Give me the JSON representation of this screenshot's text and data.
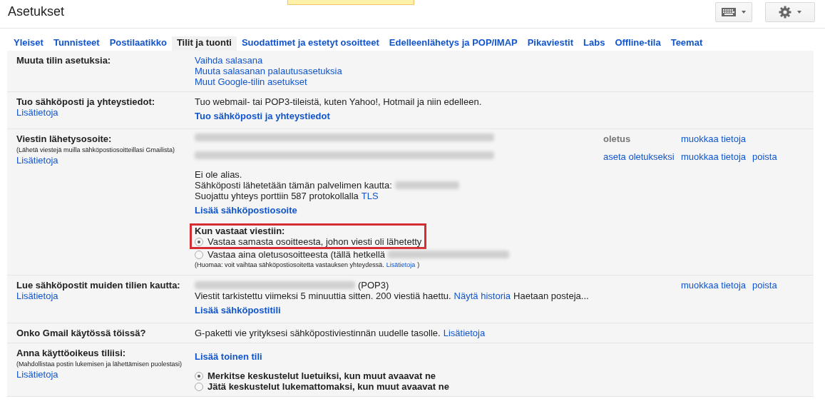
{
  "header": {
    "title": "Asetukset"
  },
  "tabs": [
    {
      "label": "Yleiset",
      "selected": false
    },
    {
      "label": "Tunnisteet",
      "selected": false
    },
    {
      "label": "Postilaatikko",
      "selected": false
    },
    {
      "label": "Tilit ja tuonti",
      "selected": true
    },
    {
      "label": "Suodattimet ja estetyt osoitteet",
      "selected": false
    },
    {
      "label": "Edelleenlähetys ja POP/IMAP",
      "selected": false
    },
    {
      "label": "Pikaviestit",
      "selected": false
    },
    {
      "label": "Labs",
      "selected": false
    },
    {
      "label": "Offline-tila",
      "selected": false
    },
    {
      "label": "Teemat",
      "selected": false
    }
  ],
  "sections": [
    {
      "title": "Muuta tilin asetuksia:",
      "lines": [
        {
          "kind": "plain",
          "parts": [
            {
              "kind": "link",
              "text": "Vaihda salasana"
            }
          ]
        },
        {
          "kind": "plain",
          "parts": [
            {
              "kind": "link",
              "text": "Muuta salasanan palautusasetuksia"
            }
          ]
        },
        {
          "kind": "plain",
          "parts": [
            {
              "kind": "link",
              "text": "Muut Google-tilin asetukset"
            }
          ]
        }
      ]
    },
    {
      "title": "Tuo sähköposti ja yhteystiedot:",
      "info_link": "Lisätietoja",
      "lines": [
        {
          "kind": "plain",
          "parts": [
            {
              "kind": "text",
              "text": "Tuo webmail- tai POP3-tileistä, kuten Yahoo!, Hotmail ja niin edelleen."
            }
          ]
        },
        {
          "kind": "action",
          "parts": [
            {
              "kind": "link",
              "text": "Tuo sähköposti ja yhteystiedot"
            }
          ]
        }
      ]
    },
    {
      "title": "Viestin lähetysosoite:",
      "note": "(Lähetä viestejä muilla sähköpostiosoitteillasi Gmailista)",
      "info_link": "Lisätietoja",
      "lines": [
        {
          "kind": "address",
          "parts": [
            {
              "kind": "blur"
            }
          ]
        },
        {
          "kind": "address",
          "parts": [
            {
              "kind": "blur"
            }
          ]
        },
        {
          "kind": "plain",
          "parts": [
            {
              "kind": "text",
              "text": "Ei ole alias."
            }
          ]
        },
        {
          "kind": "plain",
          "parts": [
            {
              "kind": "text",
              "text": "Sähköposti lähetetään tämän palvelimen kautta:"
            },
            {
              "kind": "blur"
            }
          ]
        },
        {
          "kind": "plain",
          "parts": [
            {
              "kind": "text",
              "text": "Suojattu yhteys porttiin 587 protokollalla"
            },
            {
              "kind": "link",
              "text": "TLS"
            }
          ]
        },
        {
          "kind": "action",
          "parts": [
            {
              "kind": "link",
              "text": "Lisää sähköpostiosoite"
            }
          ]
        },
        {
          "kind": "heading",
          "highlighted": true,
          "parts": [
            {
              "kind": "text",
              "text": "Kun vastaat viestiin:"
            }
          ]
        },
        {
          "kind": "radio",
          "selected": true,
          "bold": false,
          "highlighted": true,
          "parts": [
            {
              "kind": "text",
              "text": "Vastaa samasta osoitteesta, johon viesti oli lähetetty"
            }
          ]
        },
        {
          "kind": "radio",
          "selected": false,
          "bold": false,
          "parts": [
            {
              "kind": "text",
              "text": "Vastaa aina oletusosoitteesta (tällä hetkellä"
            },
            {
              "kind": "blur"
            }
          ]
        },
        {
          "kind": "note",
          "parts": [
            {
              "kind": "text",
              "text": "(Huomaa: voit vaihtaa sähköpostiosoitetta vastauksen yhteydessä."
            },
            {
              "kind": "link",
              "text": "Lisätietoja"
            },
            {
              "kind": "text",
              "text": ")"
            }
          ]
        }
      ],
      "actions": [
        [
          {
            "kind": "status",
            "text": "oletus"
          },
          {
            "kind": "edit",
            "text": "muokkaa tietoja"
          }
        ],
        [
          {
            "kind": "set_default",
            "text": "aseta oletukseksi"
          },
          {
            "kind": "edit",
            "text": "muokkaa tietoja"
          },
          {
            "kind": "delete",
            "text": "poista"
          }
        ]
      ]
    },
    {
      "title": "Lue sähköpostit muiden tilien kautta:",
      "info_link": "Lisätietoja",
      "lines": [
        {
          "kind": "plain",
          "parts": [
            {
              "kind": "blur"
            },
            {
              "kind": "text",
              "text": "(POP3)"
            }
          ]
        },
        {
          "kind": "plain",
          "parts": [
            {
              "kind": "text",
              "text": "Viestit tarkistettu viimeksi 5 minuuttia sitten. 200 viestiä haettu."
            },
            {
              "kind": "link",
              "text": "Näytä historia"
            },
            {
              "kind": "text",
              "text": "Haetaan posteja..."
            }
          ]
        },
        {
          "kind": "action",
          "parts": [
            {
              "kind": "link",
              "text": "Lisää sähköpostitili"
            }
          ]
        }
      ],
      "actions": [
        [
          {
            "kind": "edit",
            "text": "muokkaa tietoja"
          },
          {
            "kind": "delete",
            "text": "poista"
          }
        ]
      ]
    },
    {
      "title": "Onko Gmail käytössä töissä?",
      "lines": [
        {
          "kind": "plain",
          "parts": [
            {
              "kind": "text",
              "text": "G-paketti vie yrityksesi sähköpostiviestinnän uudelle tasolle."
            },
            {
              "kind": "link",
              "text": "Lisätietoja"
            }
          ]
        }
      ]
    },
    {
      "title": "Anna käyttöoikeus tiliisi:",
      "note": "(Mahdollistaa postin lukemisen ja lähettämisen puolestasi)",
      "info_link": "Lisätietoja",
      "lines": [
        {
          "kind": "action",
          "parts": [
            {
              "kind": "link",
              "text": "Lisää toinen tili"
            }
          ]
        },
        {
          "kind": "radio",
          "selected": true,
          "bold": true,
          "parts": [
            {
              "kind": "text",
              "text": "Merkitse keskustelut luetuiksi, kun muut avaavat ne"
            }
          ]
        },
        {
          "kind": "radio",
          "selected": false,
          "bold": true,
          "parts": [
            {
              "kind": "text",
              "text": "Jätä keskustelut lukemattomaksi, kun muut avaavat ne"
            }
          ]
        }
      ]
    }
  ]
}
